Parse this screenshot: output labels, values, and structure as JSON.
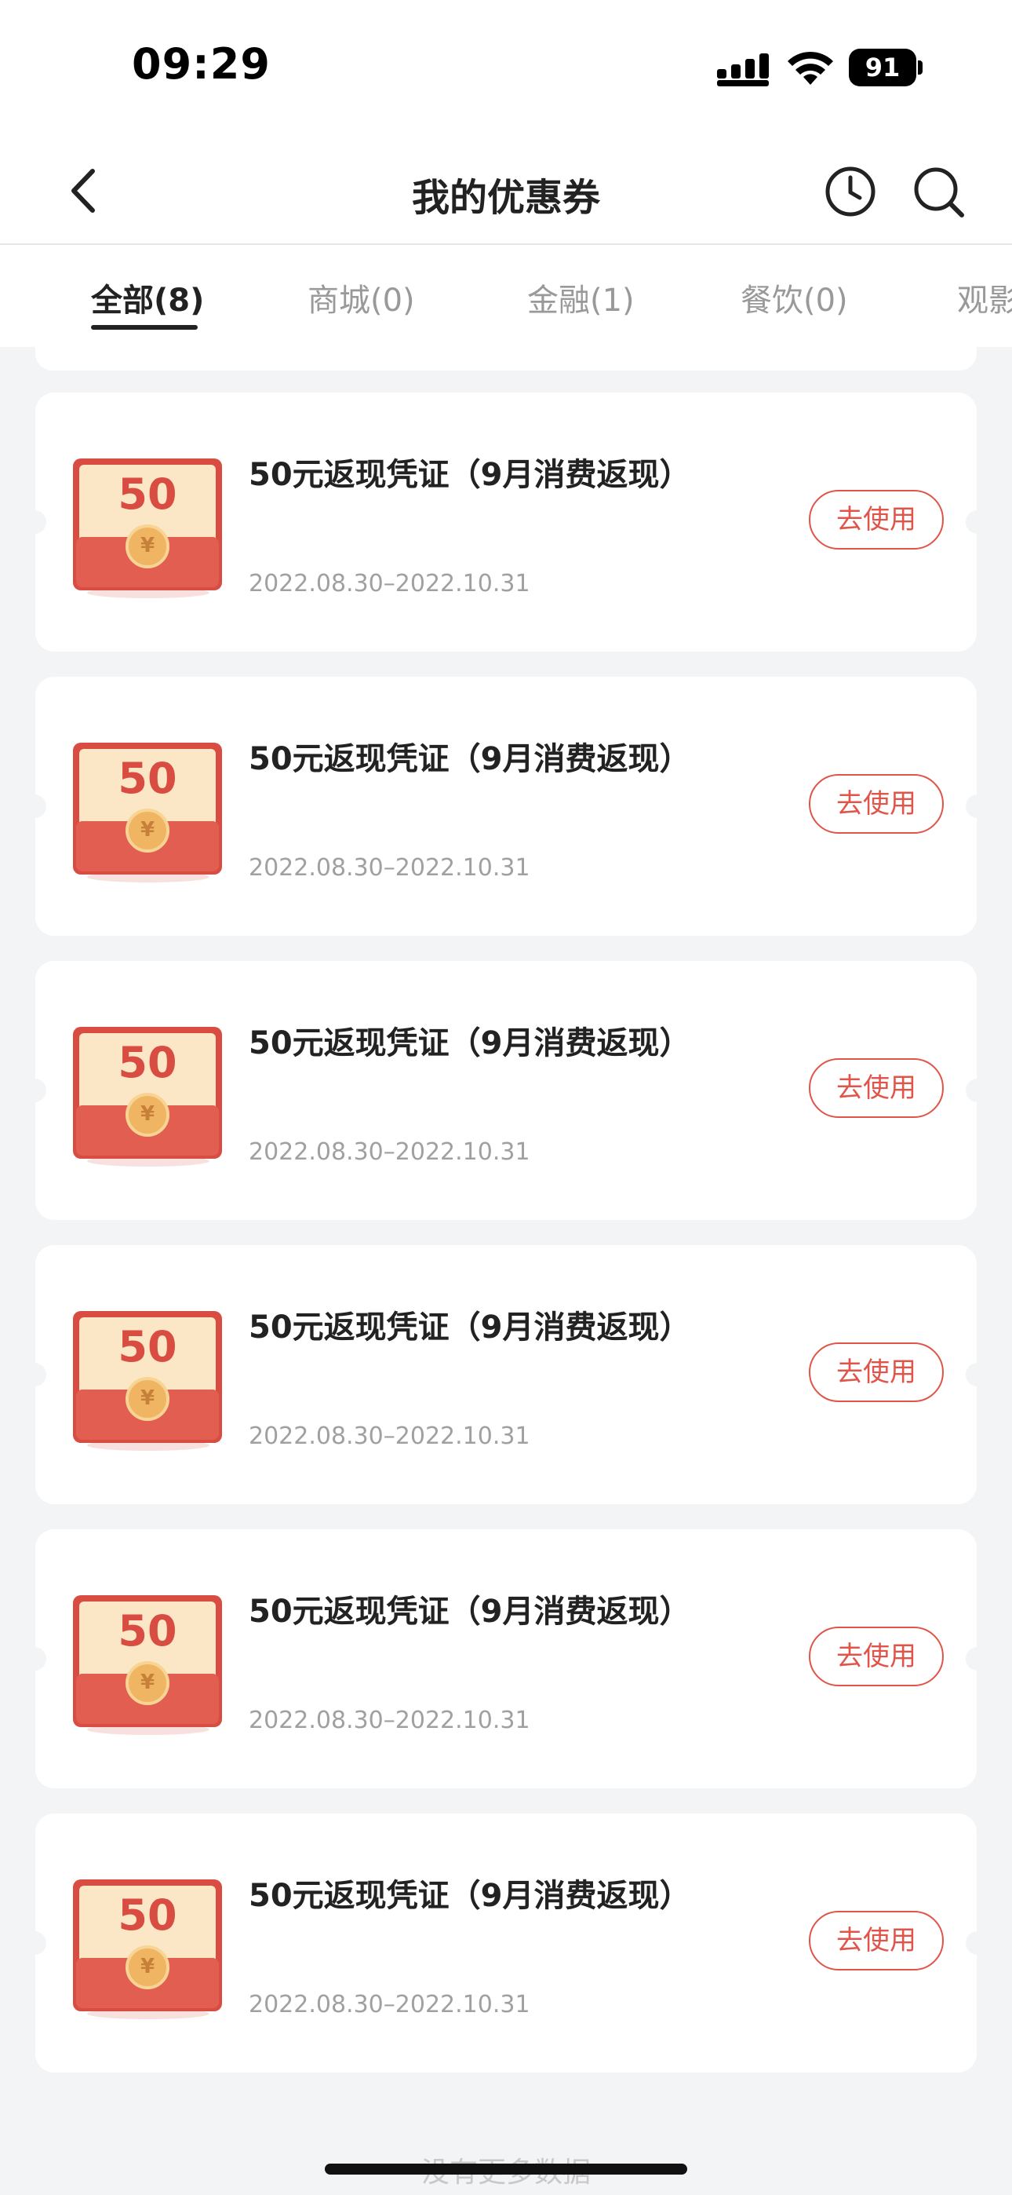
{
  "status_bar": {
    "time": "09:29",
    "battery": "91"
  },
  "header": {
    "title": "我的优惠券"
  },
  "tabs": [
    {
      "label": "全部(8)",
      "active": true
    },
    {
      "label": "商城(0)",
      "active": false
    },
    {
      "label": "金融(1)",
      "active": false
    },
    {
      "label": "餐饮(0)",
      "active": false
    },
    {
      "label": "观影",
      "active": false
    }
  ],
  "coupons": [
    {
      "amount": "50",
      "title": "50元返现凭证（9月消费返现）",
      "date": "2022.08.30–2022.10.31",
      "button": "去使用"
    },
    {
      "amount": "50",
      "title": "50元返现凭证（9月消费返现）",
      "date": "2022.08.30–2022.10.31",
      "button": "去使用"
    },
    {
      "amount": "50",
      "title": "50元返现凭证（9月消费返现）",
      "date": "2022.08.30–2022.10.31",
      "button": "去使用"
    },
    {
      "amount": "50",
      "title": "50元返现凭证（9月消费返现）",
      "date": "2022.08.30–2022.10.31",
      "button": "去使用"
    },
    {
      "amount": "50",
      "title": "50元返现凭证（9月消费返现）",
      "date": "2022.08.30–2022.10.31",
      "button": "去使用"
    },
    {
      "amount": "50",
      "title": "50元返现凭证（9月消费返现）",
      "date": "2022.08.30–2022.10.31",
      "button": "去使用"
    }
  ],
  "coin_symbol": "¥",
  "footer": {
    "text": "没有更多数据"
  },
  "colors": {
    "accent": "#e05449",
    "background": "#f3f4f6",
    "envelope": "#d84c42",
    "paper": "#fbe7c6"
  }
}
